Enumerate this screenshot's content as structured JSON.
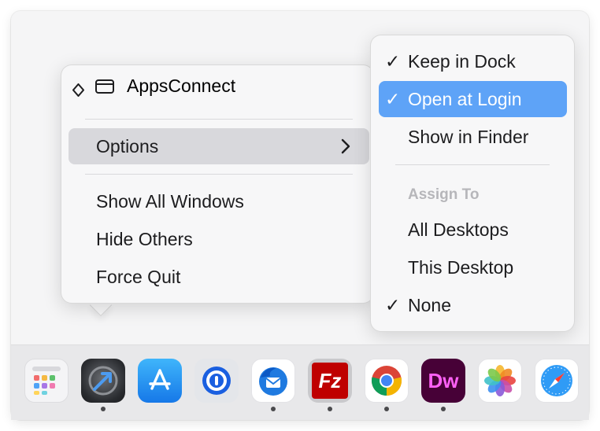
{
  "main_menu": {
    "app_name": "AppsConnect",
    "options_label": "Options",
    "items": [
      "Show All Windows",
      "Hide Others",
      "Force Quit"
    ]
  },
  "options_submenu": {
    "keep_in_dock": "Keep in Dock",
    "open_at_login": "Open at Login",
    "show_in_finder": "Show in Finder",
    "assign_to_header": "Assign To",
    "all_desktops": "All Desktops",
    "this_desktop": "This Desktop",
    "none": "None",
    "checked": [
      "Keep in Dock",
      "Open at Login",
      "None"
    ]
  },
  "dock": {
    "icons": [
      {
        "name": "launchpad-icon",
        "running": false
      },
      {
        "name": "appsconnect-icon",
        "running": true
      },
      {
        "name": "app-store-icon",
        "running": false
      },
      {
        "name": "1password-icon",
        "running": false
      },
      {
        "name": "thunderbird-icon",
        "running": true
      },
      {
        "name": "filezilla-icon",
        "running": true
      },
      {
        "name": "chrome-icon",
        "running": true
      },
      {
        "name": "dreamweaver-icon",
        "running": true
      },
      {
        "name": "photos-icon",
        "running": false
      },
      {
        "name": "safari-icon",
        "running": false
      }
    ],
    "filezilla_label": "Fz",
    "dreamweaver_label": "Dw"
  },
  "colors": {
    "highlight_blue": "#5ea3f7",
    "highlight_gray": "#d8d8dc"
  }
}
